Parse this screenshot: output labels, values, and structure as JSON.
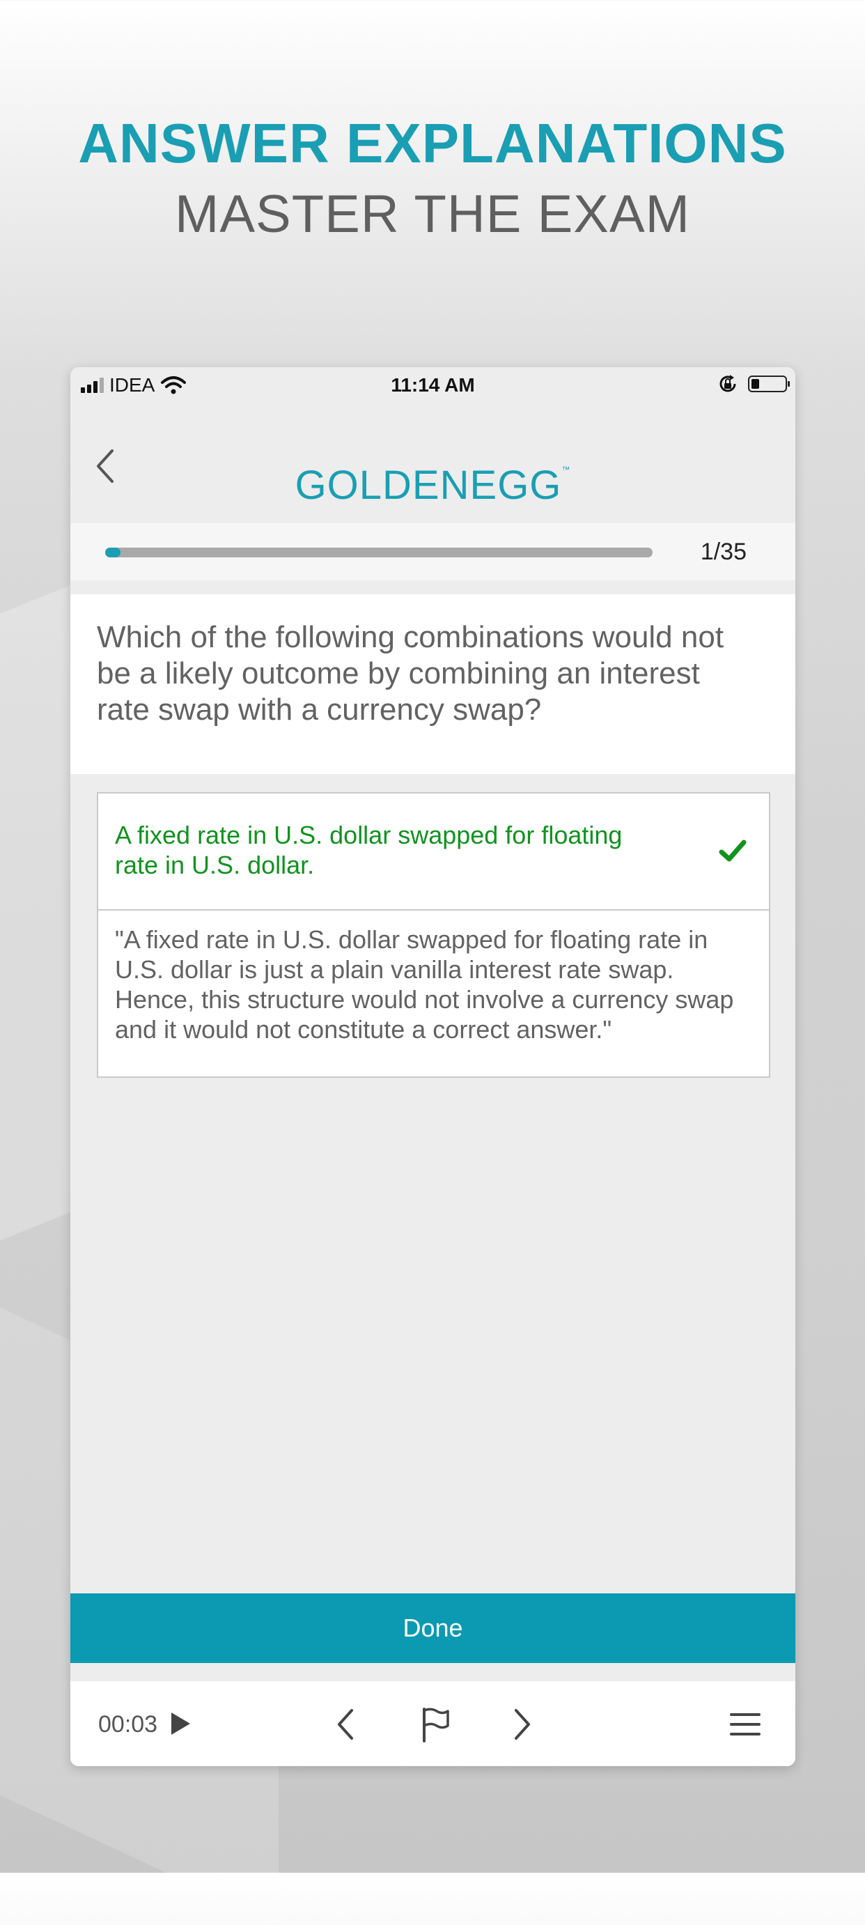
{
  "promo": {
    "headline": "ANSWER EXPLANATIONS",
    "subheadline": "MASTER THE EXAM"
  },
  "status_bar": {
    "carrier": "IDEA",
    "time": "11:14 AM"
  },
  "header": {
    "logo_text": "GOLDENEGG",
    "logo_tm": "™"
  },
  "progress": {
    "counter": "1/35",
    "fraction": 0.028
  },
  "question": {
    "text": "Which of the following combinations would not be a likely outcome by combining an interest rate swap with a currency swap?"
  },
  "answer": {
    "text": "A fixed rate in U.S. dollar swapped for floating rate in U.S. dollar.",
    "status": "correct",
    "explanation": "\"A fixed rate in U.S. dollar swapped for floating rate in U.S. dollar is just a plain vanilla interest rate swap. Hence, this structure would not involve a currency swap and it would not constitute a correct answer.\""
  },
  "actions": {
    "done_label": "Done"
  },
  "footer": {
    "timer": "00:03"
  },
  "colors": {
    "accent": "#1a9eb3",
    "done_button": "#0b9ab2",
    "correct_green": "#11921f",
    "text_gray": "#626262"
  },
  "icons": [
    "signal-icon",
    "wifi-icon",
    "orientation-lock-icon",
    "battery-icon",
    "back-chevron-icon",
    "check-icon",
    "play-icon",
    "previous-icon",
    "flag-icon",
    "next-icon",
    "menu-icon"
  ]
}
